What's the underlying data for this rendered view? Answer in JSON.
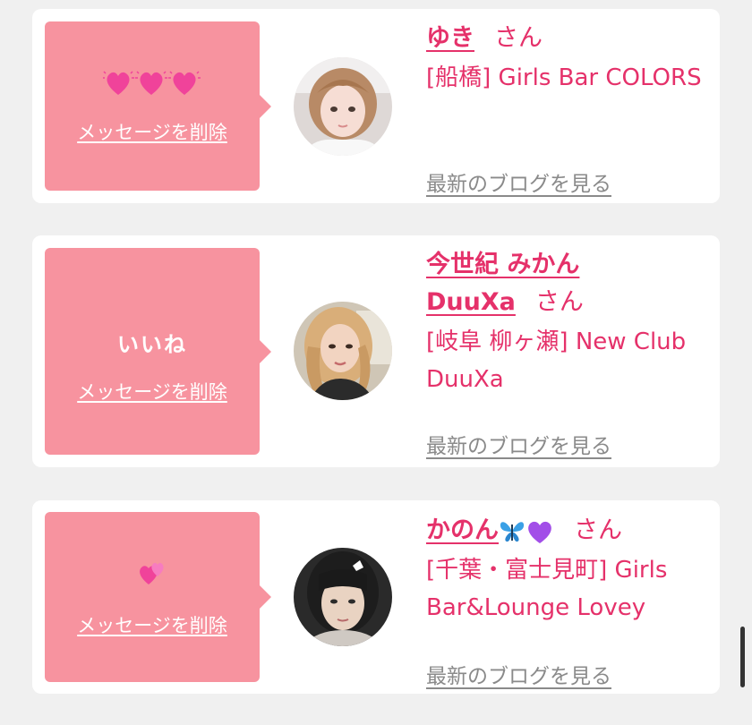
{
  "cards": [
    {
      "message_emoji": "heart-icons",
      "delete_label": "メッセージを削除",
      "name": "ゆき",
      "honorific": "さん",
      "shop": "[船橋] Girls Bar COLORS",
      "blog_label": "最新のブログを見る"
    },
    {
      "message": "いいね",
      "delete_label": "メッセージを削除",
      "name": "今世紀 みかん DuuXa",
      "honorific": "さん",
      "shop": "[岐阜 柳ヶ瀬] New Club DuuXa",
      "blog_label": "最新のブログを見る"
    },
    {
      "message_emoji": "two-hearts-icon",
      "delete_label": "メッセージを削除",
      "name": "かのん",
      "name_emoji": [
        "butterfly-icon",
        "purple-heart-icon"
      ],
      "honorific": "さん",
      "shop": "[千葉・富士見町] Girls Bar&Lounge Lovey",
      "blog_label": "最新のブログを見る"
    }
  ],
  "colors": {
    "background": "#f0f0f0",
    "card": "#ffffff",
    "bubble": "#f7939f",
    "accent": "#e5316a",
    "link_gray": "#8a8a8a"
  }
}
